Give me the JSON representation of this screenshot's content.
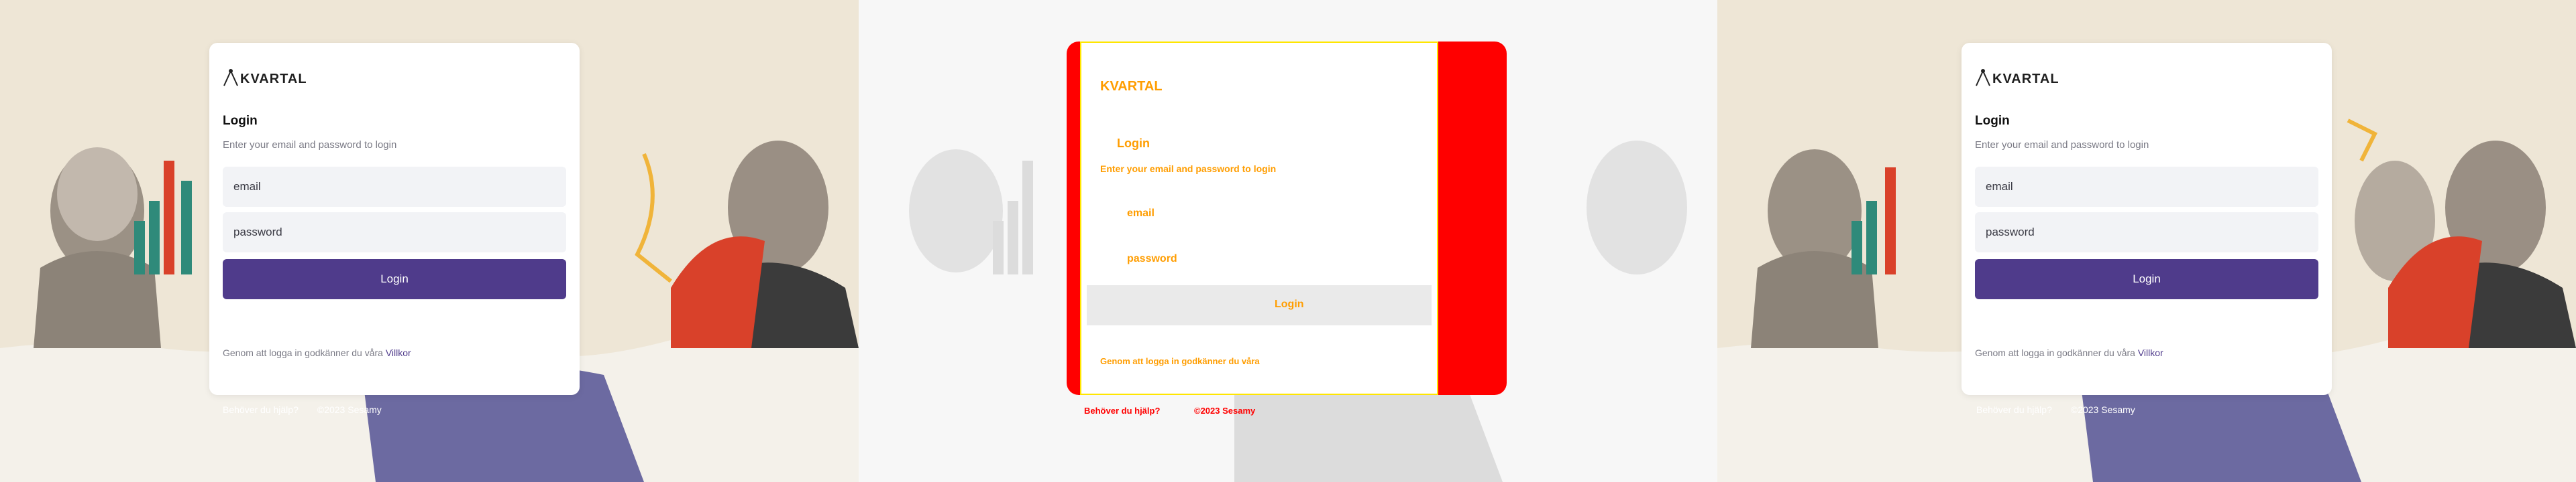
{
  "brand": "KVARTAL",
  "login": {
    "title": "Login",
    "subtitle": "Enter your email and password to login",
    "email_placeholder": "email",
    "password_placeholder": "password",
    "button_label": "Login"
  },
  "terms": {
    "text": "Genom att logga in godkänner du våra",
    "link": "Villkor"
  },
  "footer": {
    "help": "Behöver du hjälp?",
    "copyright": "©2023 Sesamy"
  },
  "colors": {
    "accent": "#4f3b8b",
    "background": "#eee6d6"
  }
}
